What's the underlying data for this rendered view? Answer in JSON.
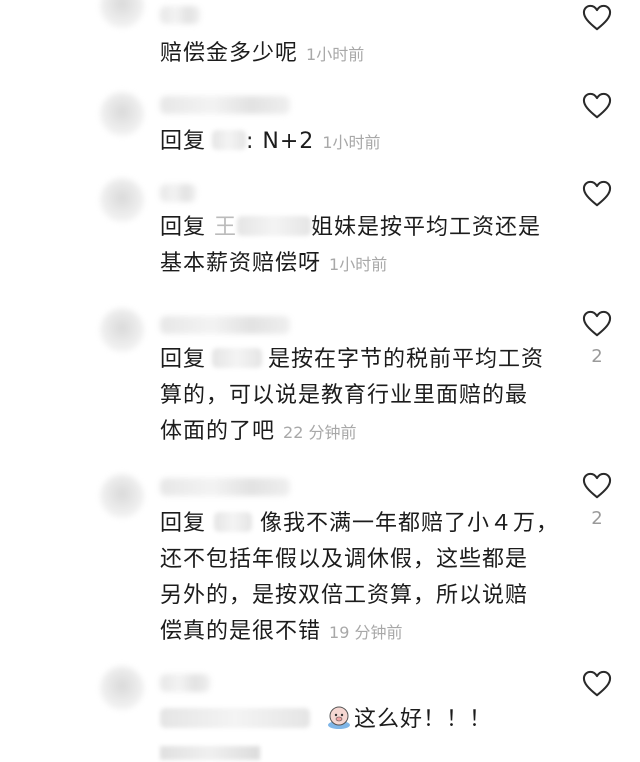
{
  "comments": [
    {
      "text": "赔偿金多少呢",
      "time": "1小时前",
      "likes": ""
    },
    {
      "reply_prefix": "回复",
      "text": ": N+2",
      "time": "1小时前",
      "likes": ""
    },
    {
      "reply_prefix": "回复",
      "line1_initial": "王",
      "line1_rest": "姐妹是按平均工资还是",
      "line2": "基本薪资赔偿呀",
      "time": "1小时前",
      "likes": ""
    },
    {
      "reply_prefix": "回复",
      "line1": "是按在字节的税前平均工资",
      "line2": "算的，可以说是教育行业里面赔的最",
      "line3": "体面的了吧",
      "time": "22 分钟前",
      "likes": "2"
    },
    {
      "reply_prefix": "回复",
      "line1": "像我不满一年都赔了小４万，",
      "line2": "还不包括年假以及调休假，这些都是",
      "line3": "另外的，是按双倍工资算，所以说赔",
      "line4": "偿真的是很不错",
      "time": "19 分钟前",
      "likes": "2"
    },
    {
      "text": "这么好！！！",
      "likes": ""
    }
  ],
  "icons": {
    "like": "heart-outline-icon",
    "sticker": "sticker-emoji-icon"
  },
  "colors": {
    "text": "#1c1c1c",
    "timestamp": "#a8a8a8",
    "icon": "#2a2a2a"
  }
}
